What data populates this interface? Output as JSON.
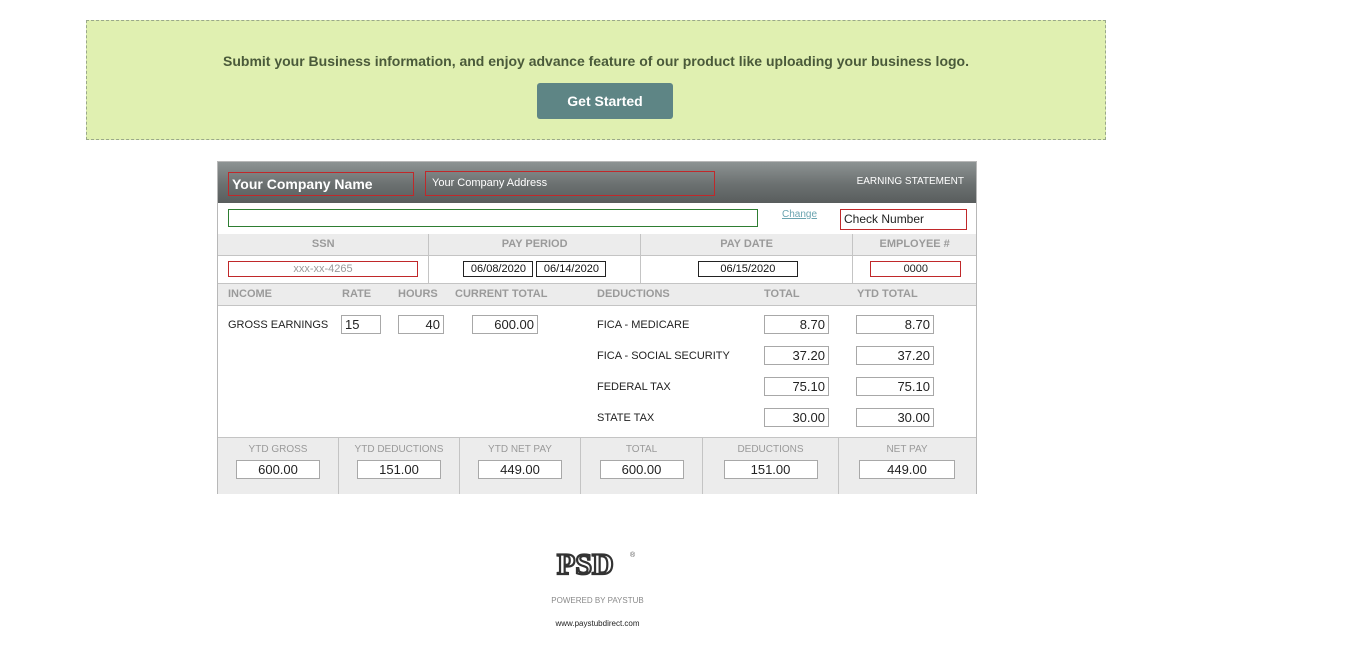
{
  "promo": {
    "message": "Submit your Business information, and enjoy advance feature of our product like uploading your business logo.",
    "button_label": "Get Started"
  },
  "stub": {
    "company_name": "Your Company Name",
    "company_address": "Your Company Address",
    "title": "EARNING STATEMENT",
    "logo_input_value": "",
    "change_link": "Change",
    "check_number": "Check Number",
    "info_headers": [
      "SSN",
      "PAY PERIOD",
      "PAY DATE",
      "EMPLOYEE #"
    ],
    "ssn": "xxx-xx-4265",
    "pay_period_start": "06/08/2020",
    "pay_period_end": "06/14/2020",
    "pay_date": "06/15/2020",
    "employee_number": "0000",
    "column_headers": {
      "income": "INCOME",
      "rate": "RATE",
      "hours": "HOURS",
      "current_total": "CURRENT TOTAL",
      "deductions": "DEDUCTIONS",
      "total": "TOTAL",
      "ytd_total": "YTD TOTAL"
    },
    "income": {
      "label": "GROSS EARNINGS",
      "rate": "15",
      "hours": "40",
      "current_total": "600.00"
    },
    "deductions": [
      {
        "label": "FICA - MEDICARE",
        "total": "8.70",
        "ytd_total": "8.70"
      },
      {
        "label": "FICA - SOCIAL SECURITY",
        "total": "37.20",
        "ytd_total": "37.20"
      },
      {
        "label": "FEDERAL TAX",
        "total": "75.10",
        "ytd_total": "75.10"
      },
      {
        "label": "STATE TAX",
        "total": "30.00",
        "ytd_total": "30.00"
      }
    ],
    "summary": [
      {
        "label": "YTD GROSS",
        "value": "600.00"
      },
      {
        "label": "YTD DEDUCTIONS",
        "value": "151.00"
      },
      {
        "label": "YTD NET PAY",
        "value": "449.00"
      },
      {
        "label": "TOTAL",
        "value": "600.00"
      },
      {
        "label": "DEDUCTIONS",
        "value": "151.00"
      },
      {
        "label": "NET PAY",
        "value": "449.00"
      }
    ]
  },
  "footer": {
    "logo_text": "PSD",
    "registered_mark": "®",
    "powered_by": "POWERED BY PAYSTUB",
    "website": "www.paystubdirect.com"
  },
  "colors": {
    "promo_bg": "#e0f0b1",
    "button_bg": "#5e8585",
    "required_border": "#c0282a",
    "logo_input_border": "#2e7d32",
    "link": "#6ba4b0"
  }
}
